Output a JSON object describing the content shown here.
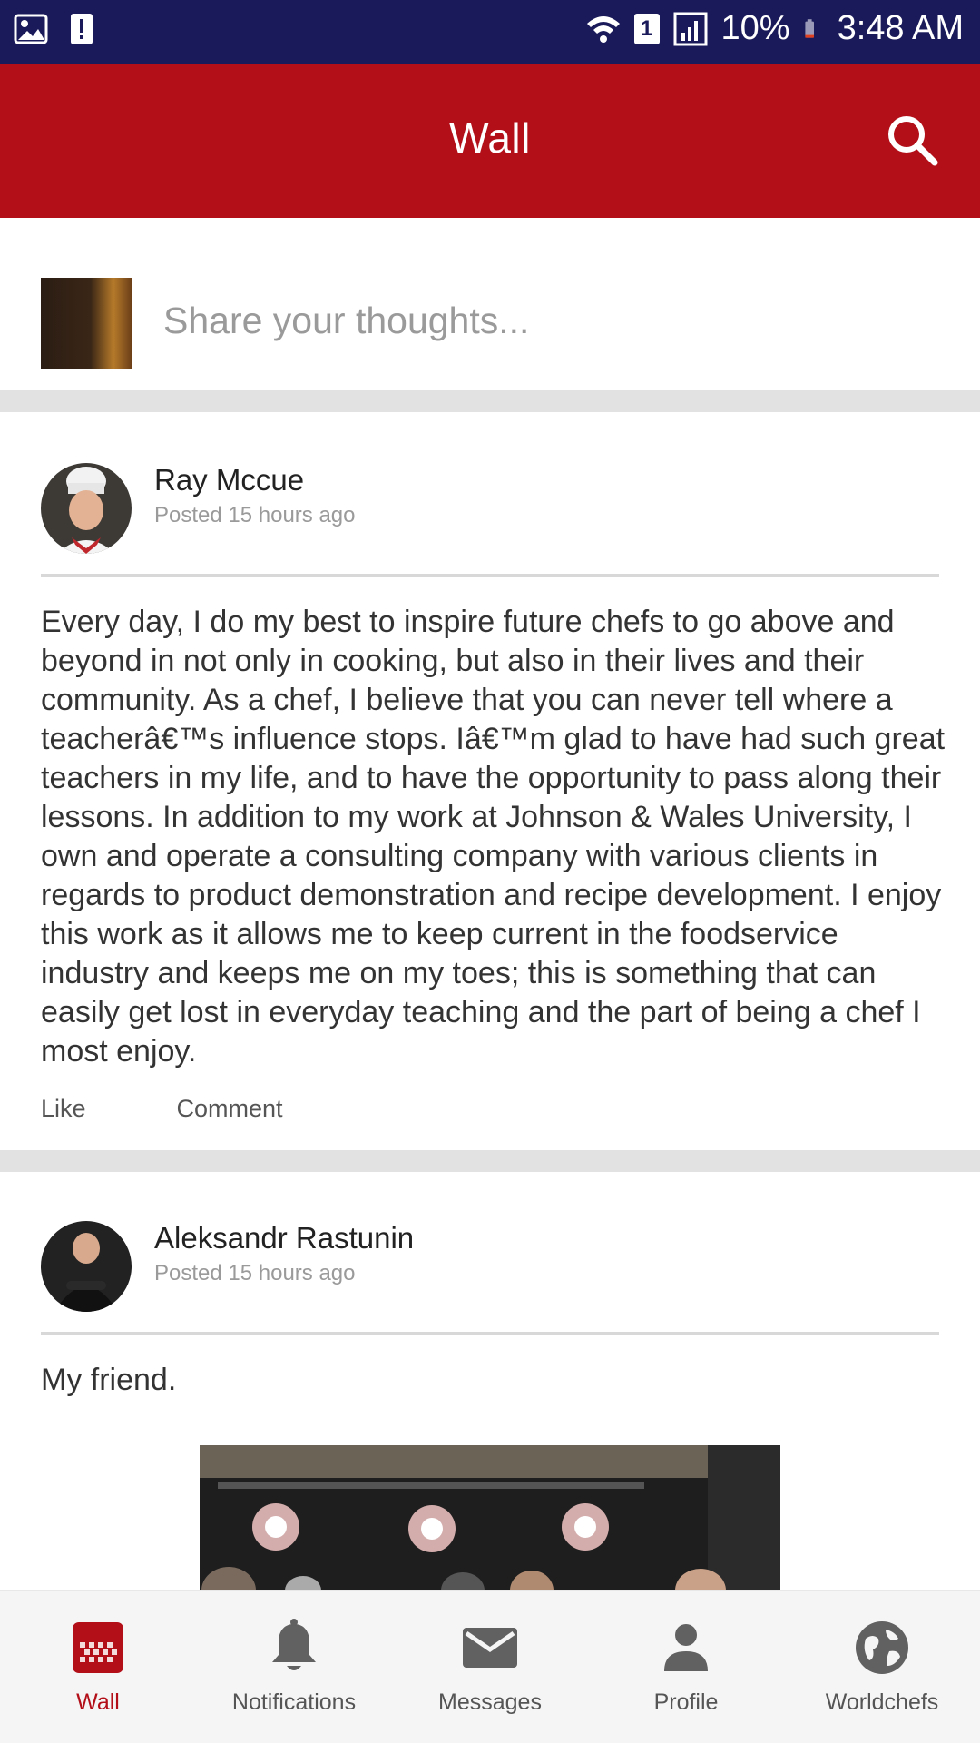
{
  "status_bar": {
    "battery": "10%",
    "time": "3:48 AM",
    "sim_slot": "1"
  },
  "app_bar": {
    "title": "Wall"
  },
  "share": {
    "placeholder": "Share your thoughts..."
  },
  "posts": [
    {
      "author": "Ray Mccue",
      "time": "Posted 15 hours ago",
      "body": "Every day, I do my best to inspire future chefs to go above and beyond in not only in cooking, but also in their lives and their community. As a chef, I believe that you can never tell where a teacherâ€™s influence stops. Iâ€™m glad to have had such great teachers in my life, and to have the opportunity to pass along their lessons. In addition to my work at Johnson & Wales University, I own and operate a consulting company with various clients in regards to product demonstration and recipe development.  I enjoy this work as it allows me to keep current in the foodservice industry and keeps me on my toes; this is something that can easily get lost in everyday teaching and the part of being a chef I most enjoy.",
      "actions": {
        "like": "Like",
        "comment": "Comment"
      }
    },
    {
      "author": "Aleksandr Rastunin",
      "time": "Posted 15 hours ago",
      "body": "My friend."
    }
  ],
  "bottom_nav": [
    {
      "label": "Wall",
      "icon": "wall-icon",
      "active": true
    },
    {
      "label": "Notifications",
      "icon": "bell-icon",
      "active": false
    },
    {
      "label": "Messages",
      "icon": "envelope-icon",
      "active": false
    },
    {
      "label": "Profile",
      "icon": "person-icon",
      "active": false
    },
    {
      "label": "Worldchefs",
      "icon": "globe-icon",
      "active": false
    }
  ],
  "colors": {
    "brand_red": "#b20f19",
    "status_bar": "#1a1a5a",
    "separator": "#e2e2e2"
  }
}
